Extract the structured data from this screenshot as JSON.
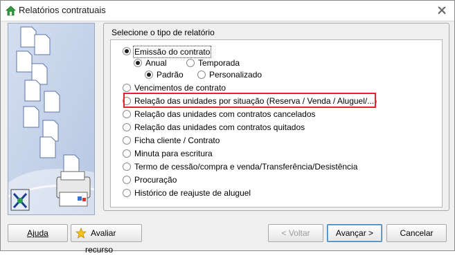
{
  "window": {
    "title": "Relatórios contratuais"
  },
  "group": {
    "title": "Selecione o tipo de relatório"
  },
  "options": {
    "emissao": "Emissão do contrato",
    "anual": "Anual",
    "temporada": "Temporada",
    "padrao": "Padrão",
    "personalizado": "Personalizado",
    "vencimentos": "Vencimentos de contrato",
    "relacao_situacao": "Relação das unidades por situação (Reserva / Venda / Aluguel/...)",
    "relacao_cancelados": "Relação das unidades com contratos cancelados",
    "relacao_quitados": "Relação das unidades com contratos quitados",
    "ficha_cliente": "Ficha cliente / Contrato",
    "minuta": "Minuta para escritura",
    "termo_cessao": "Termo de cessão/compra e venda/Transferência/Desistência",
    "procuracao": "Procuração",
    "historico": "Histórico de reajuste de aluguel"
  },
  "buttons": {
    "ajuda": "Ajuda",
    "avaliar": "Avaliar recurso",
    "voltar": "< Voltar",
    "avancar": "Avançar >",
    "cancelar": "Cancelar"
  },
  "colors": {
    "highlight": "#e0262b",
    "sidepanel": "#c7d3ea"
  }
}
